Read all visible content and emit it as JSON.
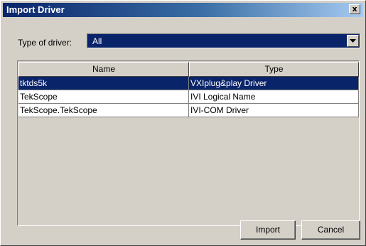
{
  "window": {
    "title": "Import Driver",
    "close_label": "x"
  },
  "filter": {
    "label": "Type of driver:",
    "selected": "All"
  },
  "table": {
    "columns": [
      "Name",
      "Type"
    ],
    "rows": [
      {
        "name": "tktds5k",
        "type": "VXIplug&play Driver",
        "selected": true
      },
      {
        "name": "TekScope",
        "type": "IVI Logical Name",
        "selected": false
      },
      {
        "name": "TekScope.TekScope",
        "type": "IVI-COM Driver",
        "selected": false
      }
    ]
  },
  "buttons": {
    "import_label": "Import",
    "cancel_label": "Cancel"
  },
  "colors": {
    "title_active": "#0a246a",
    "selection": "#0a246a",
    "face": "#d4d0c8"
  }
}
